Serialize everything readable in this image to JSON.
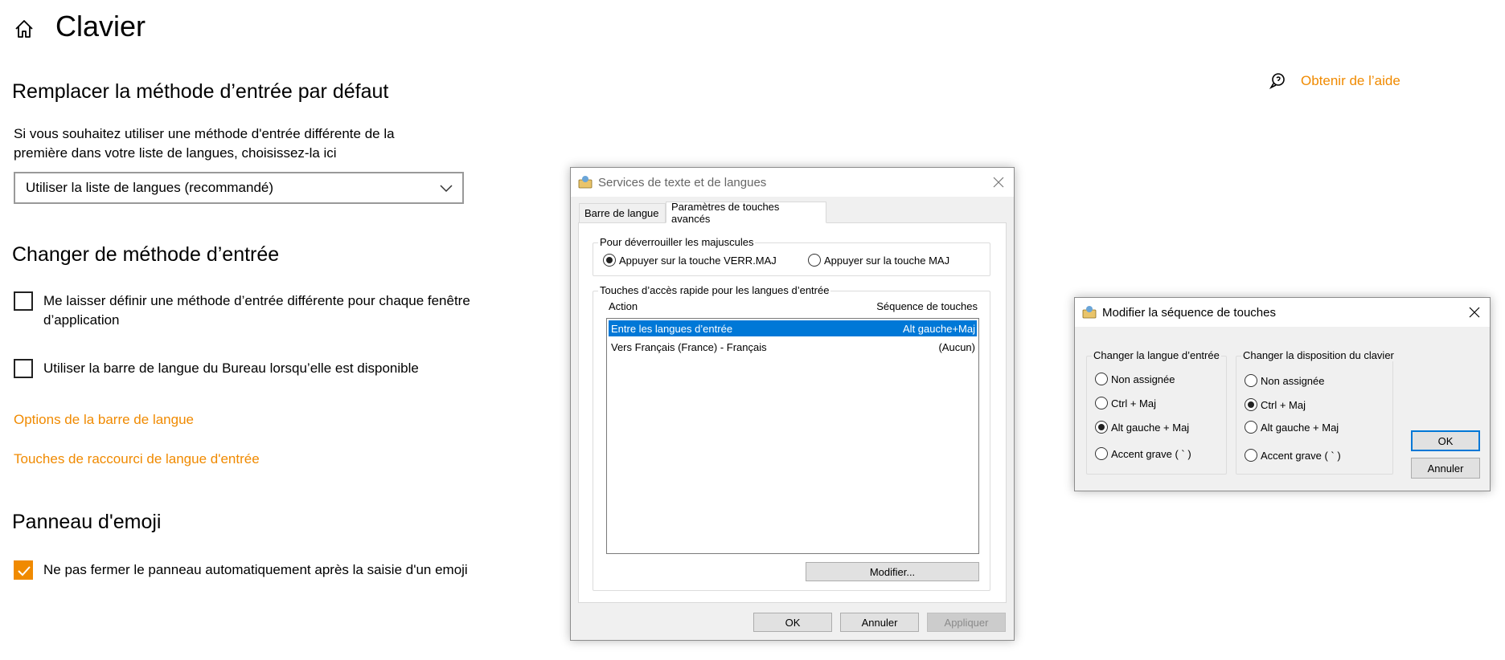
{
  "settings": {
    "title": "Clavier",
    "section_override": {
      "heading": "Remplacer la méthode d’entrée par défaut",
      "description": "Si vous souhaitez utiliser une méthode d'entrée différente de la première dans votre liste de langues, choisissez-la ici",
      "dropdown_value": "Utiliser la liste de langues (recommandé)"
    },
    "section_switch": {
      "heading": "Changer de méthode d’entrée",
      "checkbox_per_app": {
        "label": "Me laisser définir une méthode d’entrée différente pour chaque fenêtre d’application",
        "checked": false
      },
      "checkbox_langbar": {
        "label": "Utiliser la barre de langue du Bureau lorsqu’elle est disponible",
        "checked": false
      },
      "link_langbar_options": "Options de la barre de langue",
      "link_hotkeys": "Touches de raccourci de langue d'entrée"
    },
    "section_emoji": {
      "heading": "Panneau d'emoji",
      "checkbox_keep_open": {
        "label": "Ne pas fermer le panneau automatiquement après la saisie d'un emoji",
        "checked": true
      }
    },
    "help_link": "Obtenir de l’aide",
    "accent_color": "#f08a00"
  },
  "text_services_dialog": {
    "title": "Services de texte et de langues",
    "tabs": [
      "Barre de langue",
      "Paramètres de touches avancés"
    ],
    "active_tab": 1,
    "caps_group": {
      "label": "Pour déverrouiller les majuscules",
      "option_capslock": "Appuyer sur la touche VERR.MAJ",
      "option_shift": "Appuyer sur la touche MAJ",
      "selected": "capslock"
    },
    "hotkeys_group": {
      "label": "Touches d’accès rapide pour les langues d’entrée",
      "col_action": "Action",
      "col_sequence": "Séquence de touches",
      "rows": [
        {
          "action": "Entre les langues d’entrée",
          "sequence": "Alt gauche+Maj",
          "selected": true
        },
        {
          "action": "Vers Français (France) - Français",
          "sequence": "(Aucun)",
          "selected": false
        }
      ],
      "modify_button": "Modifier..."
    },
    "buttons": {
      "ok": "OK",
      "cancel": "Annuler",
      "apply": "Appliquer"
    },
    "selection_color": "#0078d7"
  },
  "key_sequence_dialog": {
    "title": "Modifier la séquence de touches",
    "group_input_language": {
      "label": "Changer la langue d’entrée",
      "options": [
        "Non assignée",
        "Ctrl + Maj",
        "Alt gauche + Maj",
        "Accent grave ( ` )"
      ],
      "selected_index": 2
    },
    "group_keyboard_layout": {
      "label": "Changer la disposition du clavier",
      "options": [
        "Non assignée",
        "Ctrl + Maj",
        "Alt gauche + Maj",
        "Accent grave ( ` )"
      ],
      "selected_index": 1
    },
    "buttons": {
      "ok": "OK",
      "cancel": "Annuler"
    }
  }
}
